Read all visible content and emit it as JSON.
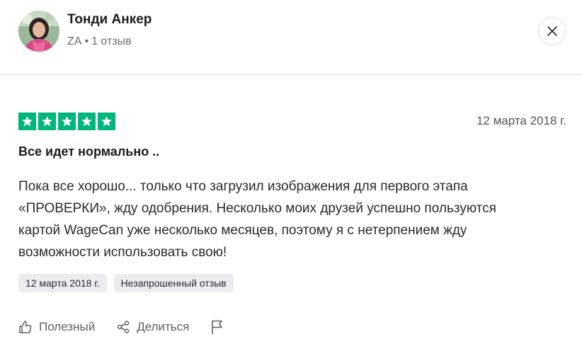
{
  "user": {
    "name": "Тонди Анкер",
    "country": "ZA",
    "separator": "•",
    "review_count": "1 отзыв"
  },
  "review": {
    "rating": 5,
    "date": "12 марта 2018 г.",
    "title": "Все идет нормально ..",
    "body_lines": [
      "Пока все хорошо... только что загрузил изображения для первого этапа",
      "«ПРОВЕРКИ», жду одобрения. Несколько моих друзей успешно пользуются",
      "картой WageCan уже несколько месяцев, поэтому я с нетерпением жду",
      "возможности использовать свою!"
    ],
    "tags": [
      "12 марта 2018 г.",
      "Незапрошенный отзыв"
    ]
  },
  "actions": {
    "useful_label": "Полезный",
    "share_label": "Делиться"
  },
  "icons": {
    "close": "close-icon",
    "star": "star-icon",
    "thumbs_up": "thumbs-up-icon",
    "share": "share-icon",
    "flag": "flag-icon"
  },
  "colors": {
    "star_green": "#00b67a",
    "tag_background": "#ececf0",
    "divider": "#dcdce6"
  }
}
